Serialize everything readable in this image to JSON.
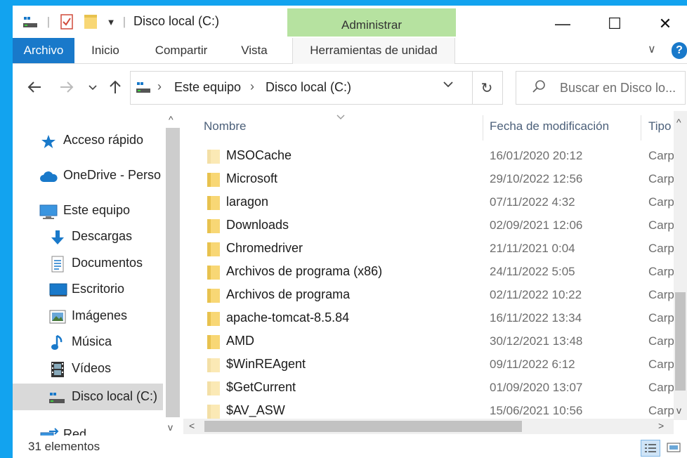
{
  "window": {
    "title": "Disco local (C:)",
    "admin_tab": "Administrar",
    "buttons": {
      "minimize": "—",
      "maximize": "☐",
      "close": "✕"
    }
  },
  "ribbon": {
    "tabs": [
      "Archivo",
      "Inicio",
      "Compartir",
      "Vista",
      "Herramientas de unidad"
    ],
    "help": "?"
  },
  "address": {
    "crumbs": [
      "Este equipo",
      "Disco local (C:)"
    ]
  },
  "search": {
    "placeholder": "Buscar en Disco lo..."
  },
  "nav_pane": {
    "items": [
      {
        "label": "Acceso rápido",
        "icon": "star-icon"
      },
      {
        "label": "OneDrive - Perso",
        "icon": "cloud-icon"
      },
      {
        "label": "Este equipo",
        "icon": "computer-icon"
      },
      {
        "label": "Descargas",
        "icon": "download-icon"
      },
      {
        "label": "Documentos",
        "icon": "document-icon"
      },
      {
        "label": "Escritorio",
        "icon": "desktop-icon"
      },
      {
        "label": "Imágenes",
        "icon": "images-icon"
      },
      {
        "label": "Música",
        "icon": "music-icon"
      },
      {
        "label": "Vídeos",
        "icon": "videos-icon"
      },
      {
        "label": "Disco local (C:)",
        "icon": "drive-icon",
        "selected": true
      },
      {
        "label": "Red",
        "icon": "network-icon"
      }
    ]
  },
  "columns": [
    "Nombre",
    "Fecha de modificación",
    "Tipo"
  ],
  "files": [
    {
      "name": "MSOCache",
      "date": "16/01/2020 20:12",
      "type": "Carp",
      "hidden": true
    },
    {
      "name": "Microsoft",
      "date": "29/10/2022 12:56",
      "type": "Carp",
      "hidden": false
    },
    {
      "name": "laragon",
      "date": "07/11/2022 4:32",
      "type": "Carp",
      "hidden": false
    },
    {
      "name": "Downloads",
      "date": "02/09/2021 12:06",
      "type": "Carp",
      "hidden": false
    },
    {
      "name": "Chromedriver",
      "date": "21/11/2021 0:04",
      "type": "Carp",
      "hidden": false
    },
    {
      "name": "Archivos de programa (x86)",
      "date": "24/11/2022 5:05",
      "type": "Carp",
      "hidden": false
    },
    {
      "name": "Archivos de programa",
      "date": "02/11/2022 10:22",
      "type": "Carp",
      "hidden": false
    },
    {
      "name": "apache-tomcat-8.5.84",
      "date": "16/11/2022 13:34",
      "type": "Carp",
      "hidden": false
    },
    {
      "name": "AMD",
      "date": "30/12/2021 13:48",
      "type": "Carp",
      "hidden": false
    },
    {
      "name": "$WinREAgent",
      "date": "09/11/2022 6:12",
      "type": "Carp",
      "hidden": true
    },
    {
      "name": "$GetCurrent",
      "date": "01/09/2020 13:07",
      "type": "Carp",
      "hidden": true
    },
    {
      "name": "$AV_ASW",
      "date": "15/06/2021 10:56",
      "type": "Carp",
      "hidden": true
    }
  ],
  "status": {
    "count": "31 elementos"
  },
  "colors": {
    "accent": "#1979ca",
    "admin_tab": "#b6e2a0",
    "folder": "#f8d775",
    "folder_hidden": "#fbe9b5",
    "background": "#12a3ef"
  }
}
